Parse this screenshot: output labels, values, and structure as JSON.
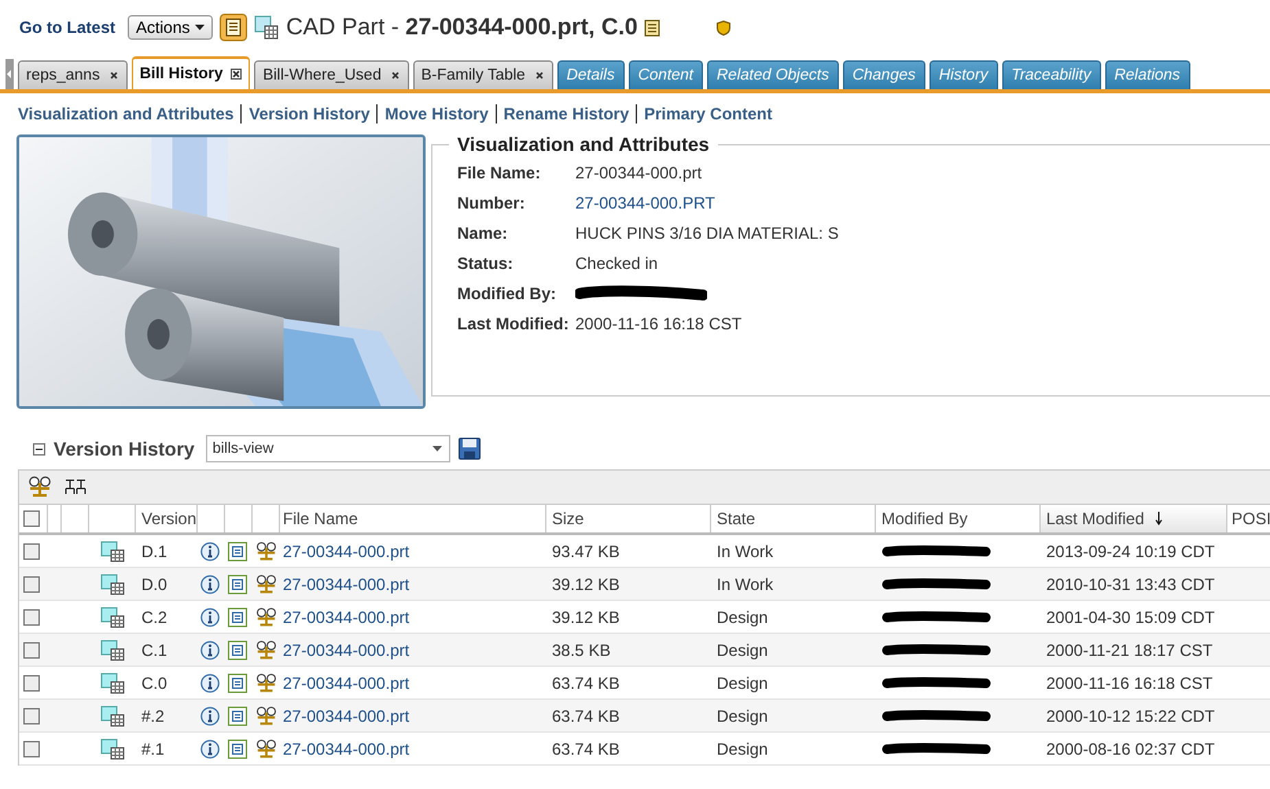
{
  "header": {
    "go_to_latest": "Go to Latest",
    "actions": "Actions",
    "object_type": "CAD Part - ",
    "object_title": "27-00344-000.prt, C.0"
  },
  "tabs": [
    {
      "label": "reps_anns",
      "selected": false,
      "closable": true
    },
    {
      "label": "Bill History",
      "selected": true,
      "closable": true
    },
    {
      "label": "Bill-Where_Used",
      "selected": false,
      "closable": true
    },
    {
      "label": "B-Family Table",
      "selected": false,
      "closable": true
    },
    {
      "label": "Details",
      "selected": false,
      "closable": false
    },
    {
      "label": "Content",
      "selected": false,
      "closable": false
    },
    {
      "label": "Related Objects",
      "selected": false,
      "closable": false
    },
    {
      "label": "Changes",
      "selected": false,
      "closable": false
    },
    {
      "label": "History",
      "selected": false,
      "closable": false
    },
    {
      "label": "Traceability",
      "selected": false,
      "closable": false
    },
    {
      "label": "Relations",
      "selected": false,
      "closable": false
    }
  ],
  "sub_links": [
    "Visualization and Attributes",
    "Version History",
    "Move History",
    "Rename History",
    "Primary Content"
  ],
  "attributes": {
    "title": "Visualization and Attributes",
    "fields": [
      {
        "label": "File Name:",
        "value": "27-00344-000.prt",
        "kind": "text"
      },
      {
        "label": "Number:",
        "value": "27-00344-000.PRT",
        "kind": "link"
      },
      {
        "label": "Name:",
        "value": "HUCK PINS 3/16 DIA MATERIAL: S",
        "kind": "text"
      },
      {
        "label": "Status:",
        "value": "Checked in",
        "kind": "text"
      },
      {
        "label": "Modified By:",
        "kind": "redacted"
      },
      {
        "label": "Last Modified:",
        "value": "2000-11-16 16:18 CST",
        "kind": "text"
      }
    ]
  },
  "version_history": {
    "title": "Version History",
    "expanded": true,
    "view": "bills-view",
    "all_checked": false,
    "columns": [
      "Version",
      "File Name",
      "Size",
      "State",
      "Modified By",
      "Last Modified",
      "POSI"
    ],
    "rows": [
      {
        "checked": false,
        "version": "D.1",
        "file_name": "27-00344-000.prt",
        "size": "93.47 KB",
        "state": "In Work",
        "modified_by_redacted": true,
        "last_modified": "2013-09-24 10:19 CDT"
      },
      {
        "checked": false,
        "version": "D.0",
        "file_name": "27-00344-000.prt",
        "size": "39.12 KB",
        "state": "In Work",
        "modified_by_redacted": true,
        "last_modified": "2010-10-31 13:43 CDT"
      },
      {
        "checked": false,
        "version": "C.2",
        "file_name": "27-00344-000.prt",
        "size": "39.12 KB",
        "state": "Design",
        "modified_by_redacted": true,
        "last_modified": "2001-04-30 15:09 CDT"
      },
      {
        "checked": false,
        "version": "C.1",
        "file_name": "27-00344-000.prt",
        "size": "38.5 KB",
        "state": "Design",
        "modified_by_redacted": true,
        "last_modified": "2000-11-21 18:17 CST"
      },
      {
        "checked": false,
        "version": "C.0",
        "file_name": "27-00344-000.prt",
        "size": "63.74 KB",
        "state": "Design",
        "modified_by_redacted": true,
        "last_modified": "2000-11-16 16:18 CST"
      },
      {
        "checked": false,
        "version": "#.2",
        "file_name": "27-00344-000.prt",
        "size": "63.74 KB",
        "state": "Design",
        "modified_by_redacted": true,
        "last_modified": "2000-10-12 15:22 CDT"
      },
      {
        "checked": false,
        "version": "#.1",
        "file_name": "27-00344-000.prt",
        "size": "63.74 KB",
        "state": "Design",
        "modified_by_redacted": true,
        "last_modified": "2000-08-16 02:37 CDT"
      }
    ]
  }
}
